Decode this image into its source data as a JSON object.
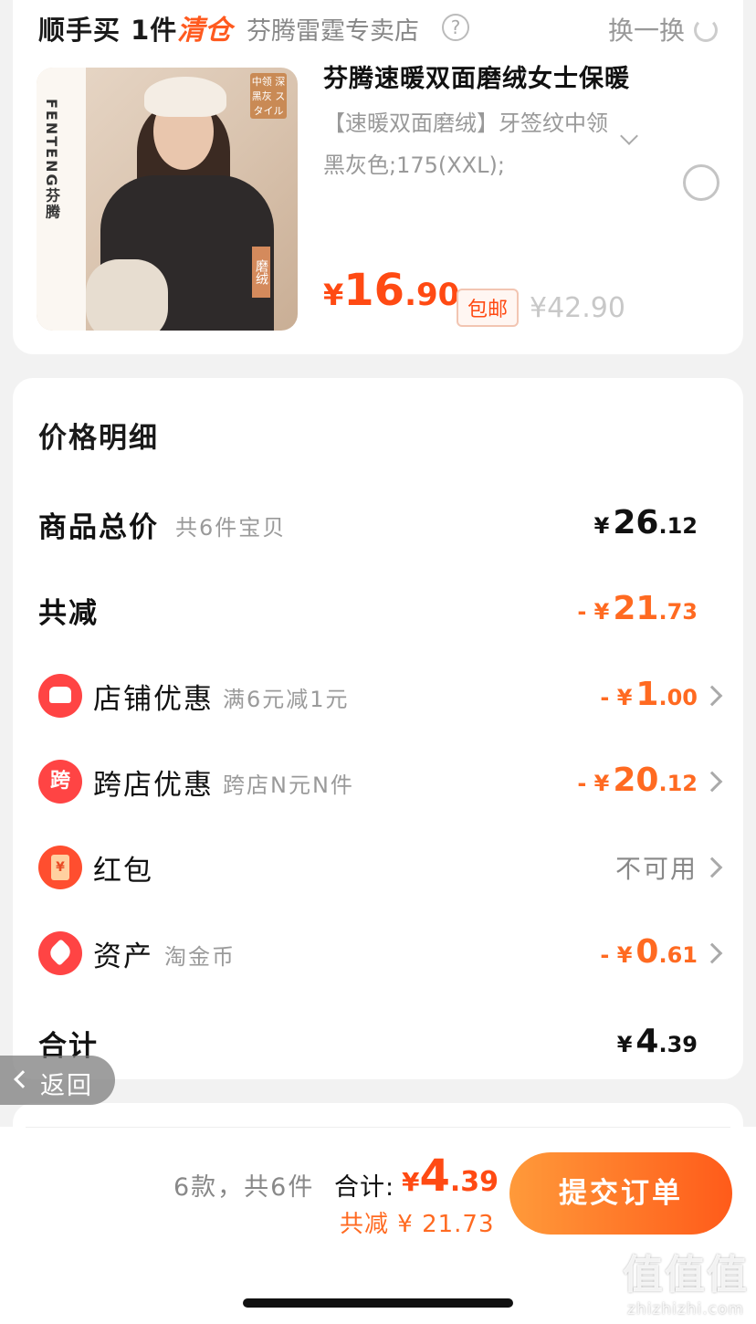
{
  "product_card": {
    "title": "顺手买 1件",
    "tag": "清仓",
    "store": "芬腾雷霆专卖店",
    "help_icon": "?",
    "swap_label": "换一换",
    "image": {
      "brand_text": "FENTENG芬腾",
      "badge_top": "中领 深黑灰 スタイル",
      "badge_side": "磨绒"
    },
    "name": "芬腾速暖双面磨绒女士保暖",
    "spec": "【速暖双面磨绒】牙签纹中领黑灰色;175(XXL);",
    "price": {
      "yen": "¥",
      "int": "16",
      "dec": ".90"
    },
    "free_shipping": "包邮",
    "original_price": "¥42.90"
  },
  "price_detail": {
    "title": "价格明细",
    "rows": [
      {
        "label": "商品总价",
        "sub": "共6件宝贝",
        "yen": "¥",
        "int": "26",
        "dec": ".12"
      },
      {
        "label": "共减",
        "sub": "",
        "prefix": "- ¥",
        "int": "21",
        "dec": ".73"
      },
      {
        "label": "店铺优惠",
        "sub": "满6元减1元",
        "prefix": "- ¥",
        "int": "1",
        "dec": ".00",
        "icon": "shop-icon"
      },
      {
        "label": "跨店优惠",
        "sub": "跨店N元N件",
        "prefix": "- ¥",
        "int": "20",
        "dec": ".12",
        "icon": "cross-store-icon",
        "icon_text": "跨"
      },
      {
        "label": "红包",
        "value": "不可用",
        "icon": "red-packet-icon"
      },
      {
        "label": "资产",
        "sub": "淘金币",
        "prefix": "- ¥",
        "int": "0",
        "dec": ".61",
        "icon": "coupon-tag-icon"
      },
      {
        "label": "合计",
        "yen": "¥",
        "int": "4",
        "dec": ".39"
      }
    ]
  },
  "back_button": {
    "label": "返回"
  },
  "bottom_bar": {
    "summary": "6款，共6件",
    "total_label": "合计:",
    "total": {
      "yen": "¥",
      "int": "4",
      "dec": ".39"
    },
    "savings": "共减 ¥ 21.73",
    "submit_label": "提交订单"
  },
  "watermark": {
    "logo": "值值值",
    "url": "zhizhizhi.com"
  },
  "colors": {
    "accent": "#ff4a13",
    "orange": "#ff6a21",
    "icon_red": "#ff4444"
  }
}
